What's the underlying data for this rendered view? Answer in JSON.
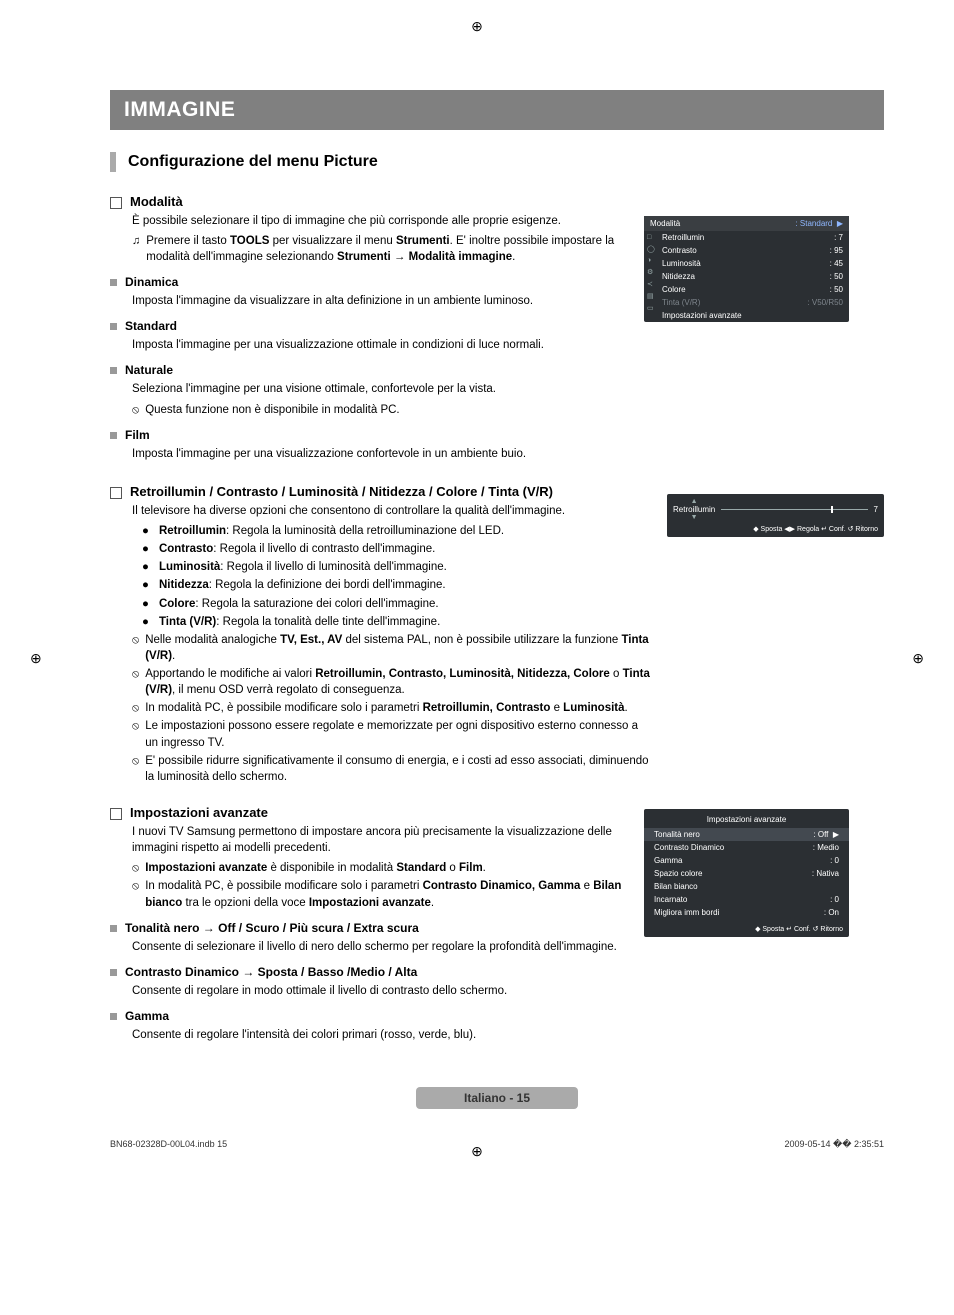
{
  "banner": "IMMAGINE",
  "sectionTitle": "Configurazione del menu Picture",
  "q": {
    "modalita": {
      "label": "Modalità",
      "intro": "È possibile selezionare il tipo di immagine che più corrisponde alle proprie esigenze.",
      "noteFull": "Premere il tasto TOOLS per visualizzare il menu Strumenti. E' inoltre possibile impostare la modalità dell'immagine selezionando Strumenti → Modalità immagine.",
      "dinamica": {
        "label": "Dinamica",
        "body": "Imposta l'immagine da visualizzare in alta definizione in un ambiente luminoso."
      },
      "standard": {
        "label": "Standard",
        "body": "Imposta l'immagine per una visualizzazione ottimale in condizioni di luce normali."
      },
      "naturale": {
        "label": "Naturale",
        "body": "Seleziona l'immagine per una visione ottimale, confortevole per la vista.",
        "note": "Questa funzione non è disponibile in modalità PC."
      },
      "film": {
        "label": "Film",
        "body": "Imposta l'immagine per una visualizzazione confortevole in un ambiente buio."
      }
    },
    "params": {
      "label": "Retroillumin / Contrasto / Luminosità / Nitidezza / Colore / Tinta (V/R)",
      "intro": "Il televisore ha diverse opzioni che consentono di controllare la qualità dell'immagine.",
      "bullets": [
        {
          "b": "Retroillumin",
          "t": ": Regola la luminosità della retroilluminazione del LED."
        },
        {
          "b": "Contrasto",
          "t": ": Regola il livello di contrasto dell'immagine."
        },
        {
          "b": "Luminosità",
          "t": ": Regola il livello di luminosità dell'immagine."
        },
        {
          "b": "Nitidezza",
          "t": ": Regola la definizione dei bordi dell'immagine."
        },
        {
          "b": "Colore",
          "t": ": Regola la saturazione dei colori dell'immagine."
        },
        {
          "b": "Tinta (V/R)",
          "t": ": Regola la tonalità delle tinte dell'immagine."
        }
      ],
      "notes": [
        "Nelle modalità analogiche TV, Est., AV del sistema PAL, non è possibile utilizzare la funzione Tinta (V/R).",
        "Apportando le modifiche ai valori Retroillumin, Contrasto, Luminosità, Nitidezza, Colore o Tinta (V/R), il menu OSD verrà regolato di conseguenza.",
        "In modalità PC, è possibile modificare solo i parametri Retroillumin, Contrasto e Luminosità.",
        "Le impostazioni possono essere regolate e memorizzate per ogni dispositivo esterno connesso a un ingresso TV.",
        "E' possibile ridurre significativamente il consumo di energia, e i costi ad esso associati, diminuendo la luminosità dello schermo."
      ]
    },
    "adv": {
      "label": "Impostazioni avanzate",
      "intro": "I nuovi TV Samsung permettono di impostare ancora più precisamente la visualizzazione delle immagini rispetto ai modelli precedenti.",
      "n1": "Impostazioni avanzate è disponibile in modalità Standard o Film.",
      "n2": "In modalità PC, è possibile modificare solo i parametri Contrasto Dinamico, Gamma e Bilan bianco tra le opzioni della voce Impostazioni avanzate.",
      "tn": {
        "label": "Tonalità nero → Off / Scuro / Più scura / Extra scura",
        "body": "Consente di selezionare il livello di nero dello schermo per regolare la profondità dell'immagine."
      },
      "cd": {
        "label": "Contrasto Dinamico → Sposta / Basso /Medio / Alta",
        "body": "Consente di regolare in modo ottimale il livello di contrasto dello schermo."
      },
      "gm": {
        "label": "Gamma",
        "body": "Consente di regolare l'intensità dei colori primari (rosso, verde, blu)."
      }
    }
  },
  "osd1": {
    "hdrL": "Modalità",
    "hdrR": ": Standard",
    "rows": [
      {
        "k": "Retroillumin",
        "v": ": 7"
      },
      {
        "k": "Contrasto",
        "v": ": 95"
      },
      {
        "k": "Luminosità",
        "v": ": 45"
      },
      {
        "k": "Nitidezza",
        "v": ": 50"
      },
      {
        "k": "Colore",
        "v": ": 50"
      },
      {
        "k": "Tinta (V/R)",
        "v": ": V50/R50"
      },
      {
        "k": "Impostazioni avanzate",
        "v": ""
      }
    ]
  },
  "osd3": {
    "label": "Retroillumin",
    "val": "7",
    "foot": "◆ Sposta   ◀▶ Regola   ↵ Conf.   ↺ Ritorno"
  },
  "osd2": {
    "title": "Impostazioni avanzate",
    "rows": [
      {
        "k": "Tonalità nero",
        "v": ": Off",
        "hl": true,
        "arrow": "▶"
      },
      {
        "k": "Contrasto Dinamico",
        "v": ": Medio"
      },
      {
        "k": "Gamma",
        "v": ": 0"
      },
      {
        "k": "Spazio colore",
        "v": ": Nativa"
      },
      {
        "k": "Bilan bianco",
        "v": ""
      },
      {
        "k": "Incarnato",
        "v": ": 0"
      },
      {
        "k": "Migliora imm bordi",
        "v": ": On"
      }
    ],
    "foot": "◆ Sposta   ↵ Conf.   ↺ Ritorno"
  },
  "footerPage": "Italiano - 15",
  "bottom": {
    "l": "BN68-02328D-00L04.indb   15",
    "r": "2009-05-14   �� 2:35:51"
  }
}
